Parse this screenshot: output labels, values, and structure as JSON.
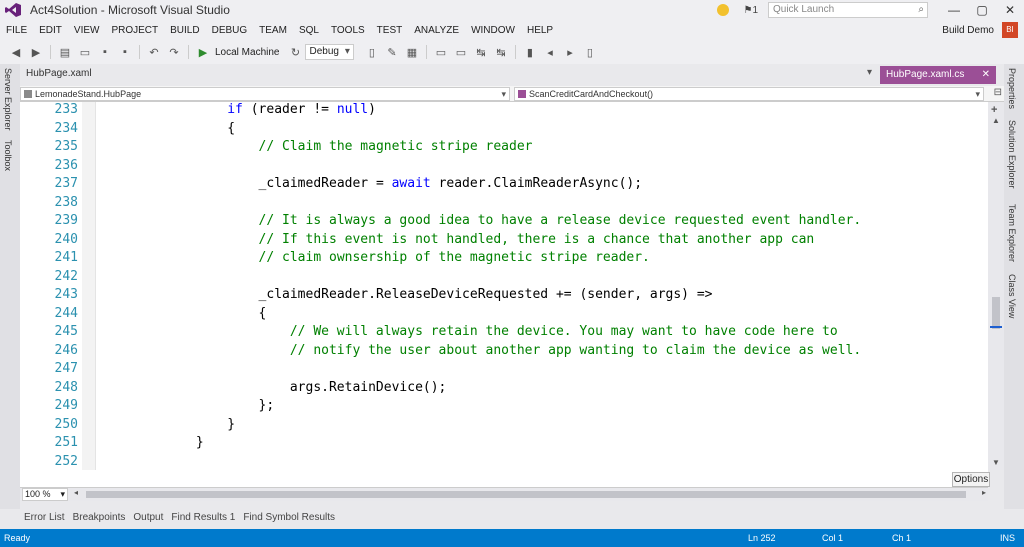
{
  "window": {
    "title": "Act4Solution - Microsoft Visual Studio",
    "quick_launch_placeholder": "Quick Launch",
    "notification_count": "1",
    "controls": [
      "—",
      "▢",
      "✕"
    ]
  },
  "menu": {
    "items": [
      "FILE",
      "EDIT",
      "VIEW",
      "PROJECT",
      "BUILD",
      "DEBUG",
      "TEAM",
      "SQL",
      "TOOLS",
      "TEST",
      "ANALYZE",
      "WINDOW",
      "HELP"
    ],
    "user_name": "Build Demo",
    "user_badge": "BI"
  },
  "toolbar": {
    "start_label": "Local Machine",
    "config_value": "Debug"
  },
  "side_panels": {
    "left": [
      "Server Explorer",
      "Toolbox"
    ],
    "right": [
      "Properties",
      "Solution Explorer",
      "Team Explorer",
      "Class View"
    ]
  },
  "tabs": {
    "preview_tab": "HubPage.xaml",
    "active_tab": "HubPage.xaml.cs",
    "active_tab_close": "✕"
  },
  "navbar": {
    "type_combo": "LemonadeStand.HubPage",
    "member_combo": "ScanCreditCardAndCheckout()"
  },
  "code_lines": [
    {
      "n": "233",
      "indent": "                ",
      "tokens": [
        {
          "t": "if",
          "c": "kw"
        },
        {
          "t": " (reader != ",
          "c": "pl"
        },
        {
          "t": "null",
          "c": "kw"
        },
        {
          "t": ")",
          "c": "pl"
        }
      ]
    },
    {
      "n": "234",
      "indent": "                ",
      "tokens": [
        {
          "t": "{",
          "c": "pl"
        }
      ]
    },
    {
      "n": "235",
      "indent": "                    ",
      "tokens": [
        {
          "t": "// Claim the magnetic stripe reader",
          "c": "cm"
        }
      ]
    },
    {
      "n": "236",
      "indent": "",
      "tokens": []
    },
    {
      "n": "237",
      "indent": "                    ",
      "tokens": [
        {
          "t": "_claimedReader = ",
          "c": "pl"
        },
        {
          "t": "await",
          "c": "kw"
        },
        {
          "t": " reader.ClaimReaderAsync();",
          "c": "pl"
        }
      ]
    },
    {
      "n": "238",
      "indent": "",
      "tokens": []
    },
    {
      "n": "239",
      "indent": "                    ",
      "tokens": [
        {
          "t": "// It is always a good idea to have a release device requested event handler.",
          "c": "cm"
        }
      ]
    },
    {
      "n": "240",
      "indent": "                    ",
      "tokens": [
        {
          "t": "// If this event is not handled, there is a chance that another app can",
          "c": "cm"
        }
      ]
    },
    {
      "n": "241",
      "indent": "                    ",
      "tokens": [
        {
          "t": "// claim ownsership of the magnetic stripe reader.",
          "c": "cm"
        }
      ]
    },
    {
      "n": "242",
      "indent": "",
      "tokens": []
    },
    {
      "n": "243",
      "indent": "                    ",
      "tokens": [
        {
          "t": "_claimedReader.ReleaseDeviceRequested += (sender, args) =>",
          "c": "pl"
        }
      ]
    },
    {
      "n": "244",
      "indent": "                    ",
      "tokens": [
        {
          "t": "{",
          "c": "pl"
        }
      ]
    },
    {
      "n": "245",
      "indent": "                        ",
      "tokens": [
        {
          "t": "// We will always retain the device. You may want to have code here to",
          "c": "cm"
        }
      ]
    },
    {
      "n": "246",
      "indent": "                        ",
      "tokens": [
        {
          "t": "// notify the user about another app wanting to claim the device as well.",
          "c": "cm"
        }
      ]
    },
    {
      "n": "247",
      "indent": "",
      "tokens": []
    },
    {
      "n": "248",
      "indent": "                        ",
      "tokens": [
        {
          "t": "args.RetainDevice();",
          "c": "pl"
        }
      ]
    },
    {
      "n": "249",
      "indent": "                    ",
      "tokens": [
        {
          "t": "};",
          "c": "pl"
        }
      ]
    },
    {
      "n": "250",
      "indent": "                ",
      "tokens": [
        {
          "t": "}",
          "c": "pl"
        }
      ]
    },
    {
      "n": "251",
      "indent": "            ",
      "tokens": [
        {
          "t": "}",
          "c": "pl"
        }
      ]
    },
    {
      "n": "252",
      "indent": "",
      "tokens": []
    }
  ],
  "editor": {
    "zoom": "100 %",
    "options_label": "Options"
  },
  "tool_tabs": [
    "Error List",
    "Breakpoints",
    "Output",
    "Find Results 1",
    "Find Symbol Results"
  ],
  "status": {
    "state": "Ready",
    "line": "Ln 252",
    "col": "Col 1",
    "ch": "Ch 1",
    "mode": "INS"
  },
  "colors": {
    "accent_tab": "#9b4f96",
    "status_bar": "#007acc",
    "keyword": "#0000ff",
    "comment": "#008000",
    "line_number": "#2b91af"
  }
}
